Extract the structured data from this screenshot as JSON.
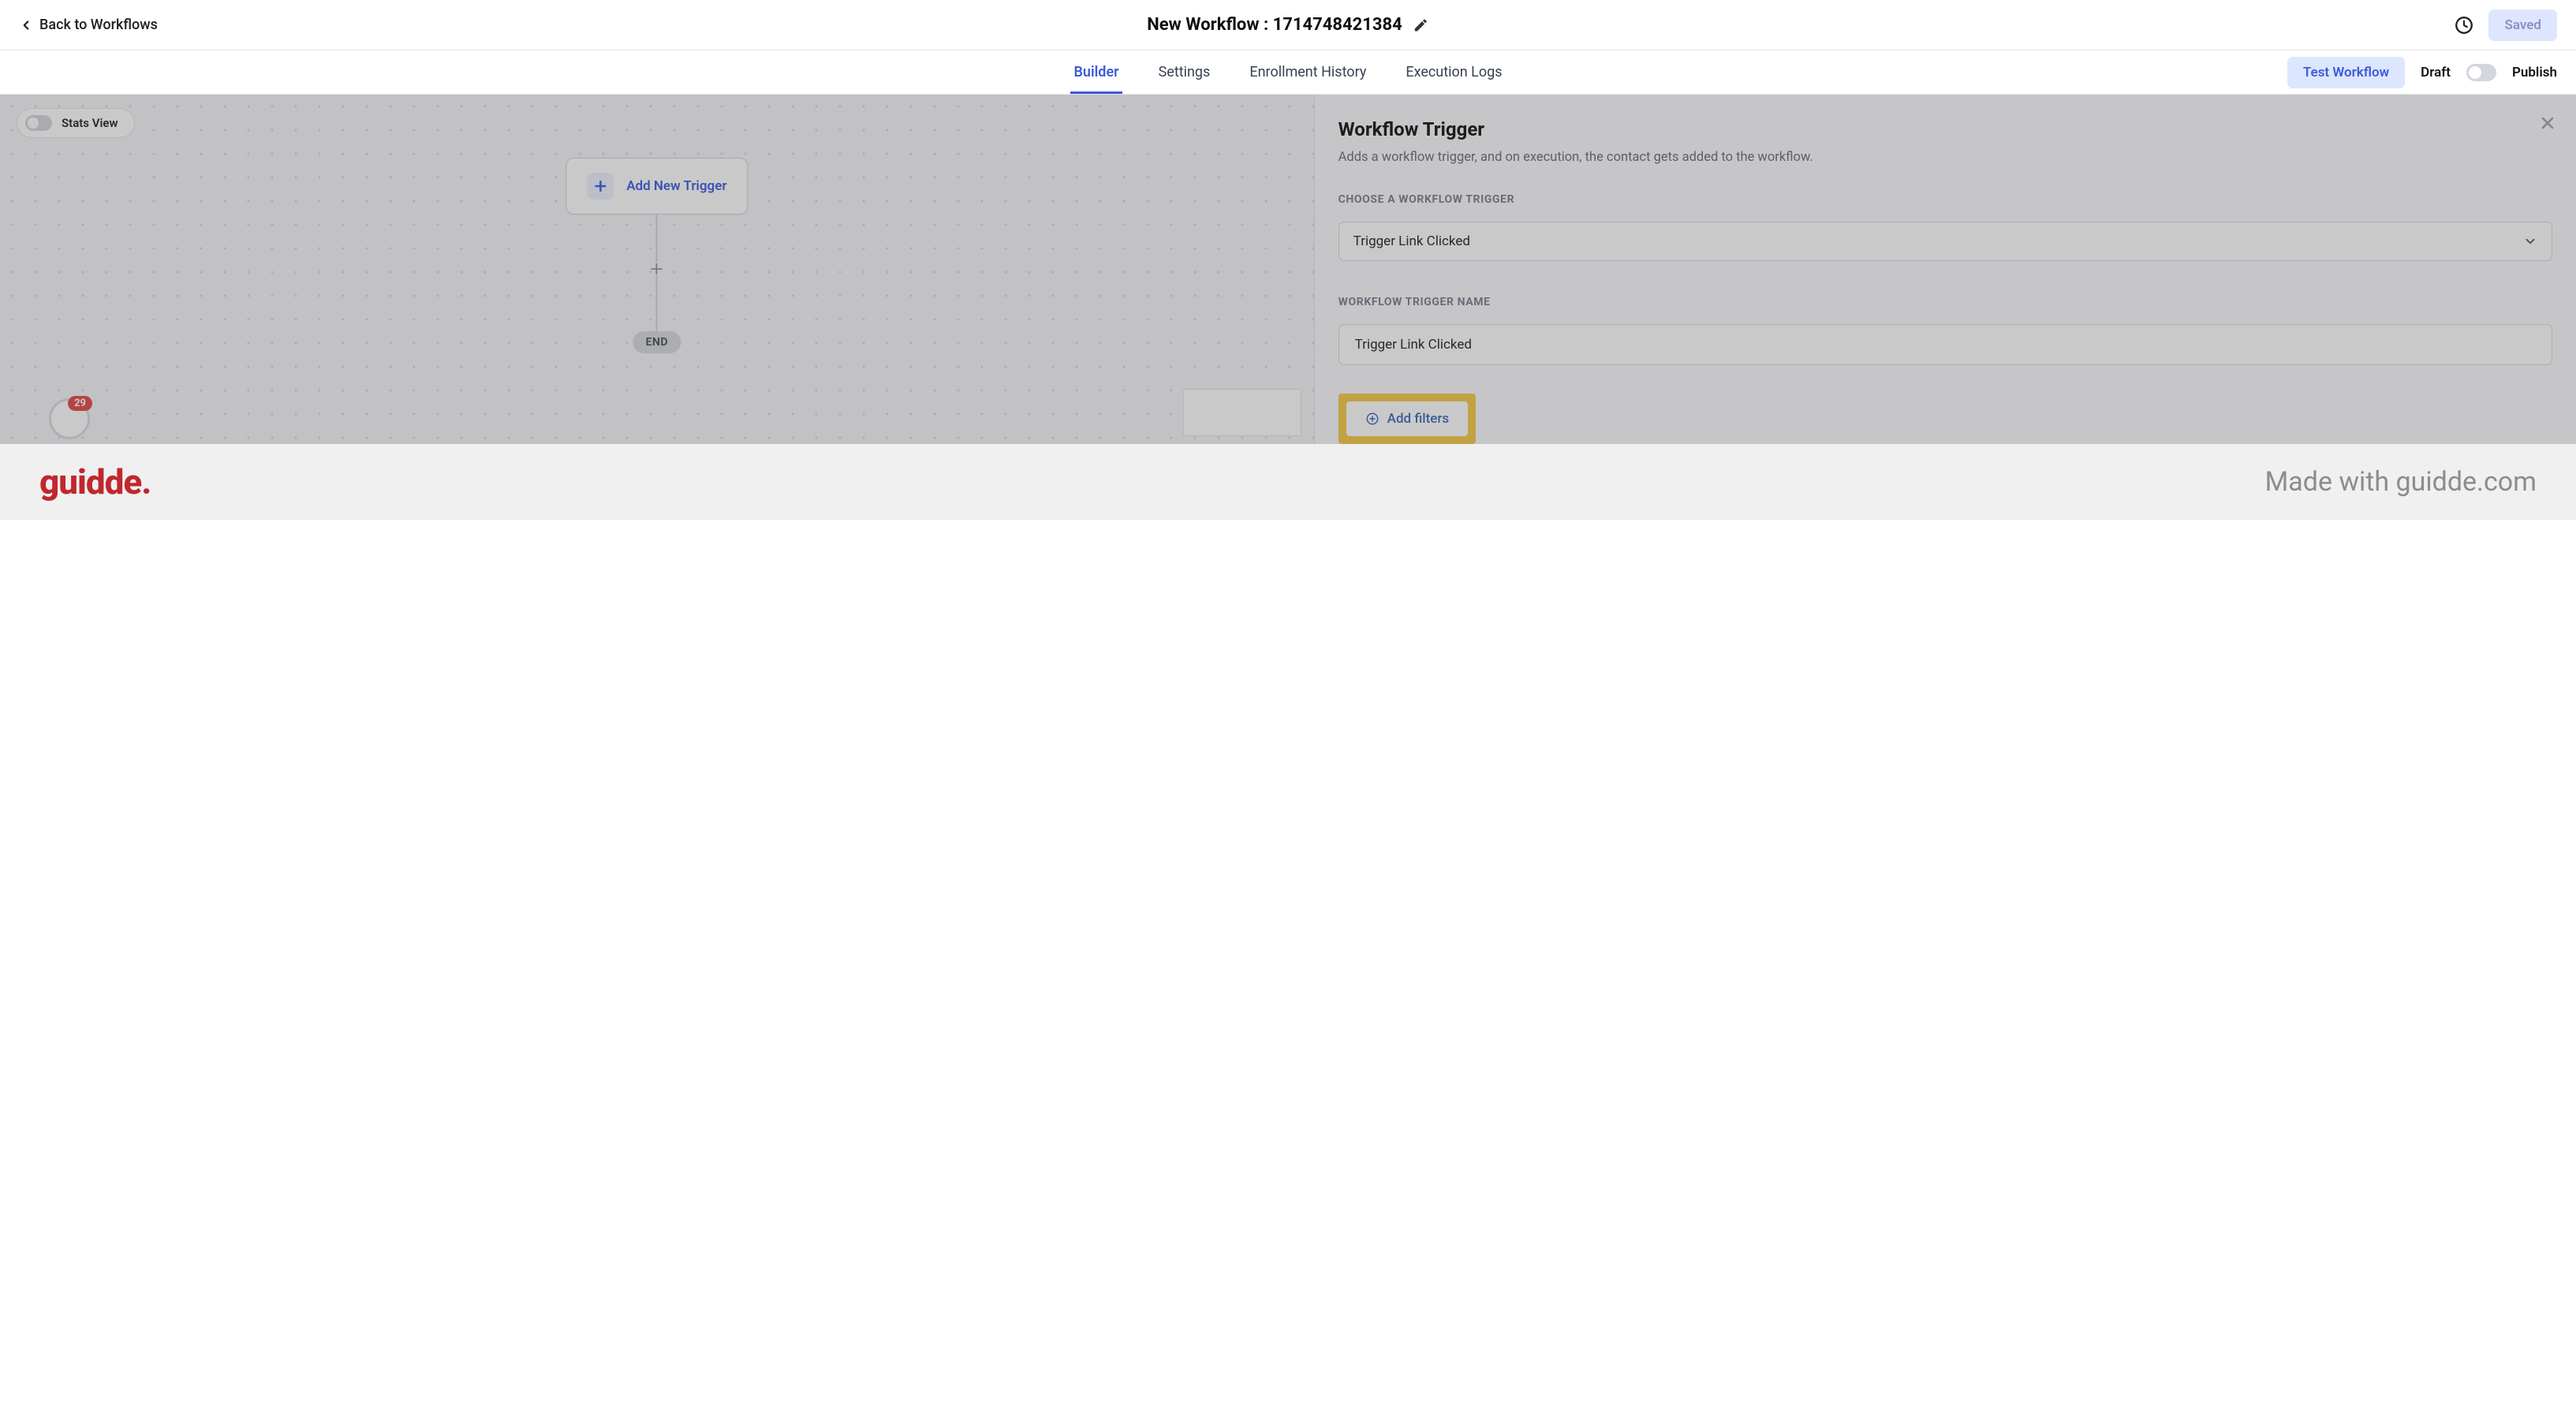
{
  "header": {
    "back_label": "Back to Workflows",
    "title": "New Workflow : 1714748421384",
    "saved_label": "Saved"
  },
  "tabs": {
    "builder": "Builder",
    "settings": "Settings",
    "enrollment": "Enrollment History",
    "execution": "Execution Logs"
  },
  "tabbar_right": {
    "test_label": "Test Workflow",
    "draft_label": "Draft",
    "publish_label": "Publish"
  },
  "canvas": {
    "stats_label": "Stats View",
    "add_trigger_label": "Add New Trigger",
    "end_label": "END",
    "notif_count": "29"
  },
  "panel": {
    "title": "Workflow Trigger",
    "subtitle": "Adds a workflow trigger, and on execution, the contact gets added to the workflow.",
    "section_choose": "CHOOSE A WORKFLOW TRIGGER",
    "trigger_dropdown_value": "Trigger Link Clicked",
    "section_name": "WORKFLOW TRIGGER NAME",
    "trigger_name_value": "Trigger Link Clicked",
    "add_filters_label": "Add filters"
  },
  "footer": {
    "logo_text": "guidde",
    "made_with": "Made with guidde.com"
  }
}
